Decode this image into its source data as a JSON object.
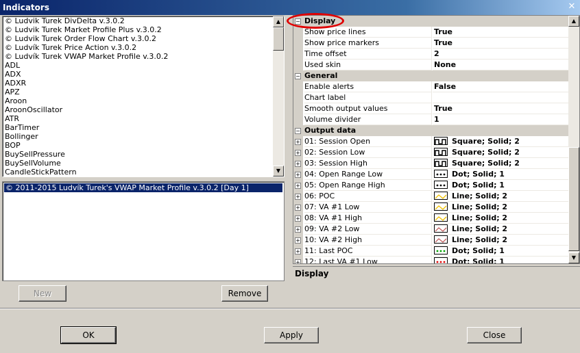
{
  "window": {
    "title": "Indicators",
    "close_glyph": "✕"
  },
  "indicator_list": [
    "© Ludvik Turek DivDelta v.3.0.2",
    "© Ludvik Turek Market Profile Plus v.3.0.2",
    "© Ludvik Turek Order Flow Chart v.3.0.2",
    "© Ludvík Turek Price Action v.3.0.2",
    "© Ludvík Turek VWAP Market Profile v.3.0.2",
    "ADL",
    "ADX",
    "ADXR",
    "APZ",
    "Aroon",
    "AroonOscillator",
    "ATR",
    "BarTimer",
    "Bollinger",
    "BOP",
    "BuySellPressure",
    "BuySellVolume",
    "CandleStickPattern"
  ],
  "selected_list": [
    "© 2011-2015 Ludvík Turek's VWAP Market Profile v.3.0.2 [Day 1]"
  ],
  "buttons": {
    "new": "New",
    "remove": "Remove",
    "ok": "OK",
    "apply": "Apply",
    "close": "Close"
  },
  "grid": {
    "display": {
      "title": "Display",
      "props": [
        {
          "name": "Show price lines",
          "value": "True"
        },
        {
          "name": "Show price markers",
          "value": "True"
        },
        {
          "name": "Time offset",
          "value": "2"
        },
        {
          "name": "Used skin",
          "value": "None"
        }
      ]
    },
    "general": {
      "title": "General",
      "props": [
        {
          "name": "Enable alerts",
          "value": "False"
        },
        {
          "name": "Chart label",
          "value": ""
        },
        {
          "name": "Smooth output values",
          "value": "True"
        },
        {
          "name": "Volume divider",
          "value": "1"
        }
      ]
    },
    "output": {
      "title": "Output data",
      "props": [
        {
          "name": "01: Session Open",
          "value": "Square; Solid; 2",
          "swatch": "square",
          "color": "#000000"
        },
        {
          "name": "02: Session Low",
          "value": "Square; Solid; 2",
          "swatch": "square",
          "color": "#000000"
        },
        {
          "name": "03: Session High",
          "value": "Square; Solid; 2",
          "swatch": "square",
          "color": "#000000"
        },
        {
          "name": "04: Open Range Low",
          "value": "Dot; Solid; 1",
          "swatch": "dot",
          "color": "#000000"
        },
        {
          "name": "05: Open Range High",
          "value": "Dot; Solid; 1",
          "swatch": "dot",
          "color": "#000000"
        },
        {
          "name": "06: POC",
          "value": "Line; Solid; 2",
          "swatch": "line",
          "color": "#f0c000"
        },
        {
          "name": "07: VA #1 Low",
          "value": "Line; Solid; 2",
          "swatch": "line",
          "color": "#f0c000"
        },
        {
          "name": "08: VA #1 High",
          "value": "Line; Solid; 2",
          "swatch": "line",
          "color": "#f0c000"
        },
        {
          "name": "09: VA #2 Low",
          "value": "Line; Solid; 2",
          "swatch": "line",
          "color": "#c06060"
        },
        {
          "name": "10: VA #2 High",
          "value": "Line; Solid; 2",
          "swatch": "line",
          "color": "#c06060"
        },
        {
          "name": "11: Last POC",
          "value": "Dot; Solid; 1",
          "swatch": "dot",
          "color": "#00a000"
        },
        {
          "name": "12: Last VA #1 Low",
          "value": "Dot; Solid; 1",
          "swatch": "dot",
          "color": "#e00000"
        }
      ]
    }
  },
  "description": {
    "title": "Display"
  },
  "colors": {
    "highlight": "#e00000",
    "selection": "#0a246a"
  }
}
